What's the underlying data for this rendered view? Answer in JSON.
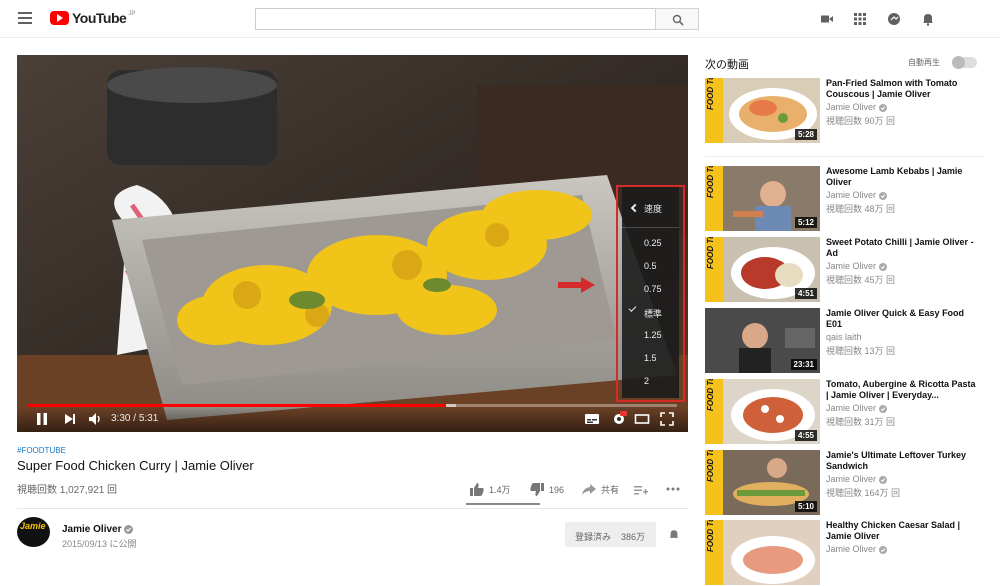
{
  "header": {
    "logo_text": "YouTube",
    "logo_region": "JP",
    "search_placeholder": ""
  },
  "player": {
    "current_time": "3:30",
    "duration": "5:31",
    "progress": 0.645,
    "buffered": 0.66,
    "speed_menu": {
      "title": "速度",
      "options": [
        "0.25",
        "0.5",
        "0.75",
        "標準",
        "1.25",
        "1.5",
        "2"
      ],
      "selected": "標準"
    }
  },
  "video": {
    "tag": "#FOODTUBE",
    "title": "Super Food Chicken Curry | Jamie Oliver",
    "views": "視聴回数 1,027,921 回",
    "likes": "1.4万",
    "dislikes": "196",
    "share_label": "共有"
  },
  "channel": {
    "avatar_text": "Jamie",
    "name": "Jamie Oliver",
    "date": "2015/09/13 に公開",
    "subscribe_label": "登録済み",
    "subscriber_count": "386万"
  },
  "sidebar": {
    "up_next_label": "次の動画",
    "autoplay_label": "自動再生",
    "autoplay_on": false,
    "recommendations": [
      {
        "title": "Pan-Fried Salmon with Tomato Couscous | Jamie Oliver",
        "channel": "Jamie Oliver",
        "views": "視聴回数 90万 回",
        "duration": "5:28",
        "foodtube": true
      },
      {
        "title": "Awesome Lamb Kebabs | Jamie Oliver",
        "channel": "Jamie Oliver",
        "views": "視聴回数 48万 回",
        "duration": "5:12",
        "foodtube": true
      },
      {
        "title": "Sweet Potato Chilli | Jamie Oliver - Ad",
        "channel": "Jamie Oliver",
        "views": "視聴回数 45万 回",
        "duration": "4:51",
        "foodtube": true
      },
      {
        "title": "Jamie Oliver Quick & Easy Food E01",
        "channel": "qais laith",
        "views": "視聴回数 13万 回",
        "duration": "23:31",
        "foodtube": false
      },
      {
        "title": "Tomato, Aubergine & Ricotta Pasta | Jamie Oliver | Everyday...",
        "channel": "Jamie Oliver",
        "views": "視聴回数 31万 回",
        "duration": "4:55",
        "foodtube": true
      },
      {
        "title": "Jamie's Ultimate Leftover Turkey Sandwich",
        "channel": "Jamie Oliver",
        "views": "視聴回数 164万 回",
        "duration": "5:10",
        "foodtube": true
      },
      {
        "title": "Healthy Chicken Caesar Salad | Jamie Oliver",
        "channel": "Jamie Oliver",
        "views": "",
        "duration": "",
        "foodtube": true
      }
    ],
    "foodtube_label": "FOOD Tube"
  },
  "colors": {
    "brand_red": "#ff0000",
    "link_blue": "#167ac6",
    "highlight_red": "#d62b2b"
  },
  "icons": [
    "hamburger-icon",
    "search-icon",
    "video-camera-icon",
    "apps-icon",
    "chat-icon",
    "bell-icon",
    "pause-icon",
    "next-icon",
    "volume-icon",
    "subtitles-icon",
    "settings-icon",
    "theater-icon",
    "fullscreen-icon",
    "thumb-up-icon",
    "thumb-down-icon",
    "share-icon",
    "add-to-playlist-icon",
    "more-icon",
    "verified-icon"
  ]
}
